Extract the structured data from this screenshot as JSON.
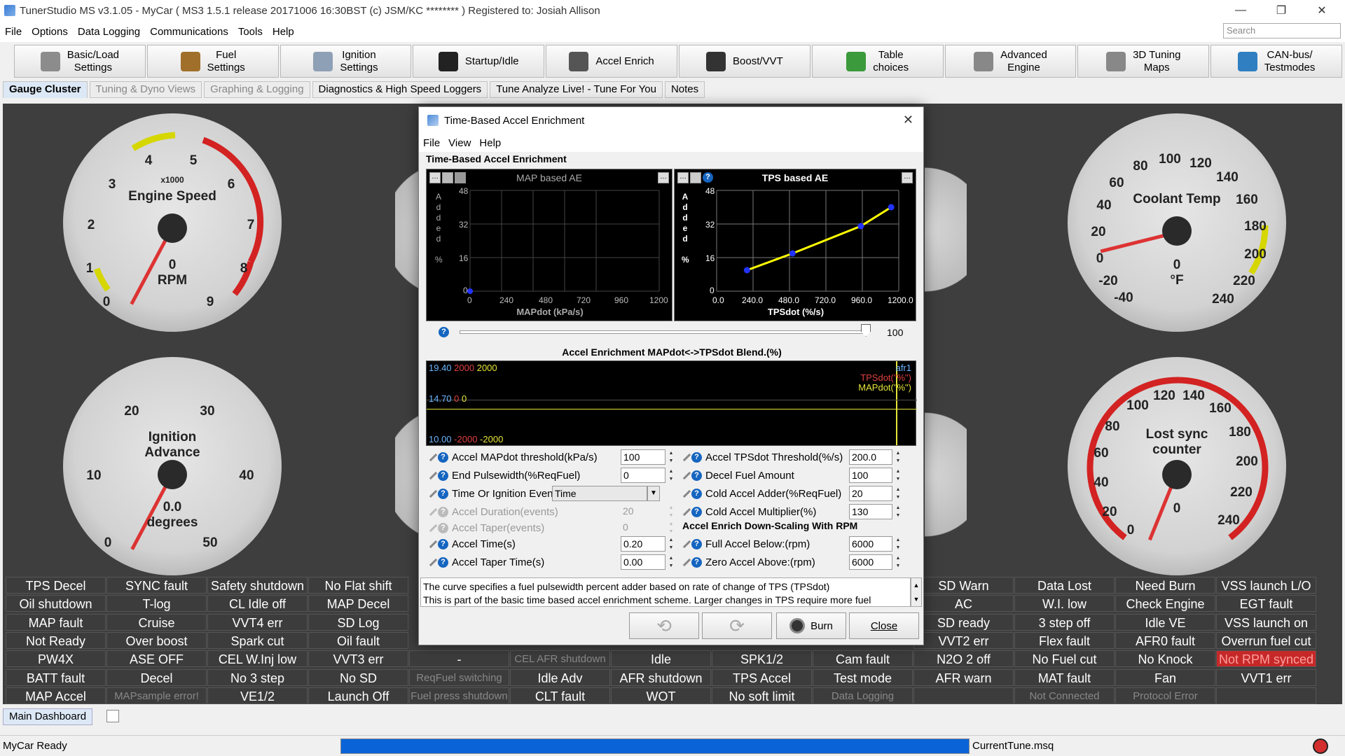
{
  "window": {
    "title": "TunerStudio MS v3.1.05 - MyCar ( MS3 1.5.1 release    20171006 16:30BST (c) JSM/KC ******** ) Registered to: Josiah Allison",
    "search_placeholder": "Search"
  },
  "menu": [
    "File",
    "Options",
    "Data Logging",
    "Communications",
    "Tools",
    "Help"
  ],
  "toolbar": [
    {
      "label": "Basic/Load\nSettings",
      "icon": "gear-icon"
    },
    {
      "label": "Fuel\nSettings",
      "icon": "fuel-injector-icon"
    },
    {
      "label": "Ignition\nSettings",
      "icon": "spark-plug-icon"
    },
    {
      "label": "Startup/Idle",
      "icon": "gauge-icon"
    },
    {
      "label": "Accel Enrich",
      "icon": "accel-icon"
    },
    {
      "label": "Boost/VVT",
      "icon": "turbo-icon"
    },
    {
      "label": "Table\nchoices",
      "icon": "table-icon"
    },
    {
      "label": "Advanced\nEngine",
      "icon": "advanced-gear-icon"
    },
    {
      "label": "3D Tuning\nMaps",
      "icon": "wrench-icon"
    },
    {
      "label": "CAN-bus/\nTestmodes",
      "icon": "network-icon"
    }
  ],
  "tabs": [
    {
      "label": "Gauge Cluster",
      "state": "active"
    },
    {
      "label": "Tuning & Dyno Views",
      "state": "dim"
    },
    {
      "label": "Graphing & Logging",
      "state": "dim"
    },
    {
      "label": "Diagnostics & High Speed Loggers",
      "state": "normal"
    },
    {
      "label": "Tune Analyze Live! - Tune For You",
      "state": "normal"
    },
    {
      "label": "Notes",
      "state": "normal"
    }
  ],
  "gauges": {
    "rpm": {
      "title": "Engine Speed",
      "scale": "x1000",
      "value": "0",
      "unit": "RPM",
      "ticks": [
        "0",
        "1",
        "2",
        "3",
        "4",
        "5",
        "6",
        "7",
        "8",
        "9"
      ]
    },
    "ignition": {
      "title": "Ignition\nAdvance",
      "value": "0.0",
      "unit": "degrees",
      "ticks": [
        "0",
        "10",
        "20",
        "30",
        "40",
        "50"
      ]
    },
    "coolant": {
      "title": "Coolant Temp",
      "value": "0",
      "unit": "°F",
      "ticks": [
        "-40",
        "-20",
        "0",
        "20",
        "40",
        "60",
        "80",
        "100",
        "120",
        "140",
        "160",
        "180",
        "200",
        "220",
        "240"
      ]
    },
    "lostsync": {
      "title": "Lost sync\ncounter",
      "value": "0",
      "ticks": [
        "0",
        "20",
        "40",
        "60",
        "80",
        "100",
        "120",
        "140",
        "160",
        "180",
        "200",
        "220",
        "240"
      ]
    }
  },
  "indicators": {
    "col1": [
      "TPS Decel",
      "Oil shutdown",
      "MAP fault",
      "Not Ready",
      "PW4X",
      "BATT fault",
      "MAP Accel"
    ],
    "col2": [
      "SYNC fault",
      "T-log",
      "Cruise",
      "Over boost",
      "ASE OFF",
      "Decel",
      "MAPsample error!"
    ],
    "col3": [
      "Safety shutdown",
      "CL Idle off",
      "VVT4 err",
      "Spark cut",
      "CEL W.Inj low",
      "No 3 step",
      "VE1/2"
    ],
    "col4": [
      "No Flat shift",
      "MAP Decel",
      "SD Log",
      "Oil fault",
      "VVT3 err",
      "No SD",
      "Launch Off"
    ],
    "col5": [
      "-",
      "ReqFuel switching",
      "Fuel press shutdown"
    ],
    "col6": [
      "CEL AFR shutdown",
      "Idle Adv",
      "CLT fault"
    ],
    "col7": [
      "Idle",
      "AFR shutdown",
      "WOT"
    ],
    "col8": [
      "SPK1/2",
      "TPS Accel",
      "No soft limit"
    ],
    "col9": [
      "Cam fault",
      "Test mode",
      "Data Logging"
    ],
    "col10": [
      "SD Warn",
      "AC",
      "SD ready",
      "VVT2 err",
      "N2O 2 off",
      "AFR warn",
      ""
    ],
    "col11": [
      "Data Lost",
      "W.I. low",
      "3 step off",
      "Flex fault",
      "No Fuel cut",
      "MAT fault",
      "Not Connected"
    ],
    "col12": [
      "Need Burn",
      "Check Engine",
      "Idle VE",
      "AFR0 fault",
      "No Knock",
      "Fan",
      "Protocol Error"
    ],
    "col13": [
      "VSS launch L/O",
      "EGT fault",
      "VSS launch on",
      "Overrun fuel cut",
      "Not RPM synced",
      "VVT1 err",
      ""
    ]
  },
  "dialog": {
    "title": "Time-Based Accel Enrichment",
    "menu": [
      "File",
      "View",
      "Help"
    ],
    "section_title": "Time-Based Accel Enrichment",
    "map_chart": {
      "title": "MAP based AE",
      "xlabel": "MAPdot (kPa/s)",
      "ylabel": "Added %",
      "yticks": [
        "48",
        "32",
        "16",
        "0"
      ],
      "xticks": [
        "0",
        "240",
        "480",
        "720",
        "960",
        "1200"
      ]
    },
    "tps_chart": {
      "title": "TPS based AE",
      "xlabel": "TPSdot (%/s)",
      "ylabel": "Added %",
      "yticks": [
        "48",
        "32",
        "16",
        "0"
      ],
      "xticks": [
        "0.0",
        "240.0",
        "480.0",
        "720.0",
        "960.0",
        "1200.0"
      ]
    },
    "blend": {
      "label": "Accel Enrichment MAPdot<->TPSdot Blend.(%)",
      "value": "100"
    },
    "trace": {
      "row1": [
        "19.40",
        "2000",
        "2000"
      ],
      "row2": [
        "14.70",
        "0",
        "0"
      ],
      "row3": [
        "10.00",
        "-2000",
        "-2000"
      ],
      "legend": [
        "afr1",
        "TPSdot(\"%\")",
        "MAPdot(\"%\")"
      ]
    },
    "left_fields": [
      {
        "label": "Accel MAPdot threshold(kPa/s)",
        "value": "100"
      },
      {
        "label": "End Pulsewidth(%ReqFuel)",
        "value": "0"
      },
      {
        "label": "Time Or Ignition Events",
        "value": "Time"
      },
      {
        "label": "Accel Duration(events)",
        "value": "20"
      },
      {
        "label": "Accel Taper(events)",
        "value": "0"
      },
      {
        "label": "Accel Time(s)",
        "value": "0.20"
      },
      {
        "label": "Accel Taper Time(s)",
        "value": "0.00"
      }
    ],
    "right_fields": [
      {
        "label": "Accel TPSdot Threshold(%/s)",
        "value": "200.0"
      },
      {
        "label": "Decel Fuel Amount",
        "value": "100"
      },
      {
        "label": "Cold Accel Adder(%ReqFuel)",
        "value": "20"
      },
      {
        "label": "Cold Accel Multiplier(%)",
        "value": "130"
      },
      {
        "label": "Full Accel Below:(rpm)",
        "value": "6000"
      },
      {
        "label": "Zero Accel Above:(rpm)",
        "value": "6000"
      }
    ],
    "rpm_section": "Accel Enrich Down-Scaling With RPM",
    "help_text": [
      "The curve specifies a fuel pulsewidth percent adder based on rate of change of TPS (TPSdot)",
      "This is part of the basic time based accel enrichment scheme. Larger changes in TPS require more fuel"
    ],
    "buttons": {
      "burn": "Burn",
      "close": "Close"
    }
  },
  "chart_data": {
    "type": "line",
    "title": "TPS based AE",
    "xlabel": "TPSdot (%/s)",
    "ylabel": "Added %",
    "x": [
      200,
      500,
      950,
      1150
    ],
    "series": [
      {
        "values": [
          10,
          18,
          31,
          40
        ]
      }
    ],
    "xlim": [
      0,
      1200
    ],
    "ylim": [
      0,
      48
    ]
  },
  "bottom": {
    "dashboard_tab": "Main Dashboard",
    "status_left": "MyCar Ready",
    "progress": 1,
    "tune_file": "CurrentTune.msq"
  }
}
